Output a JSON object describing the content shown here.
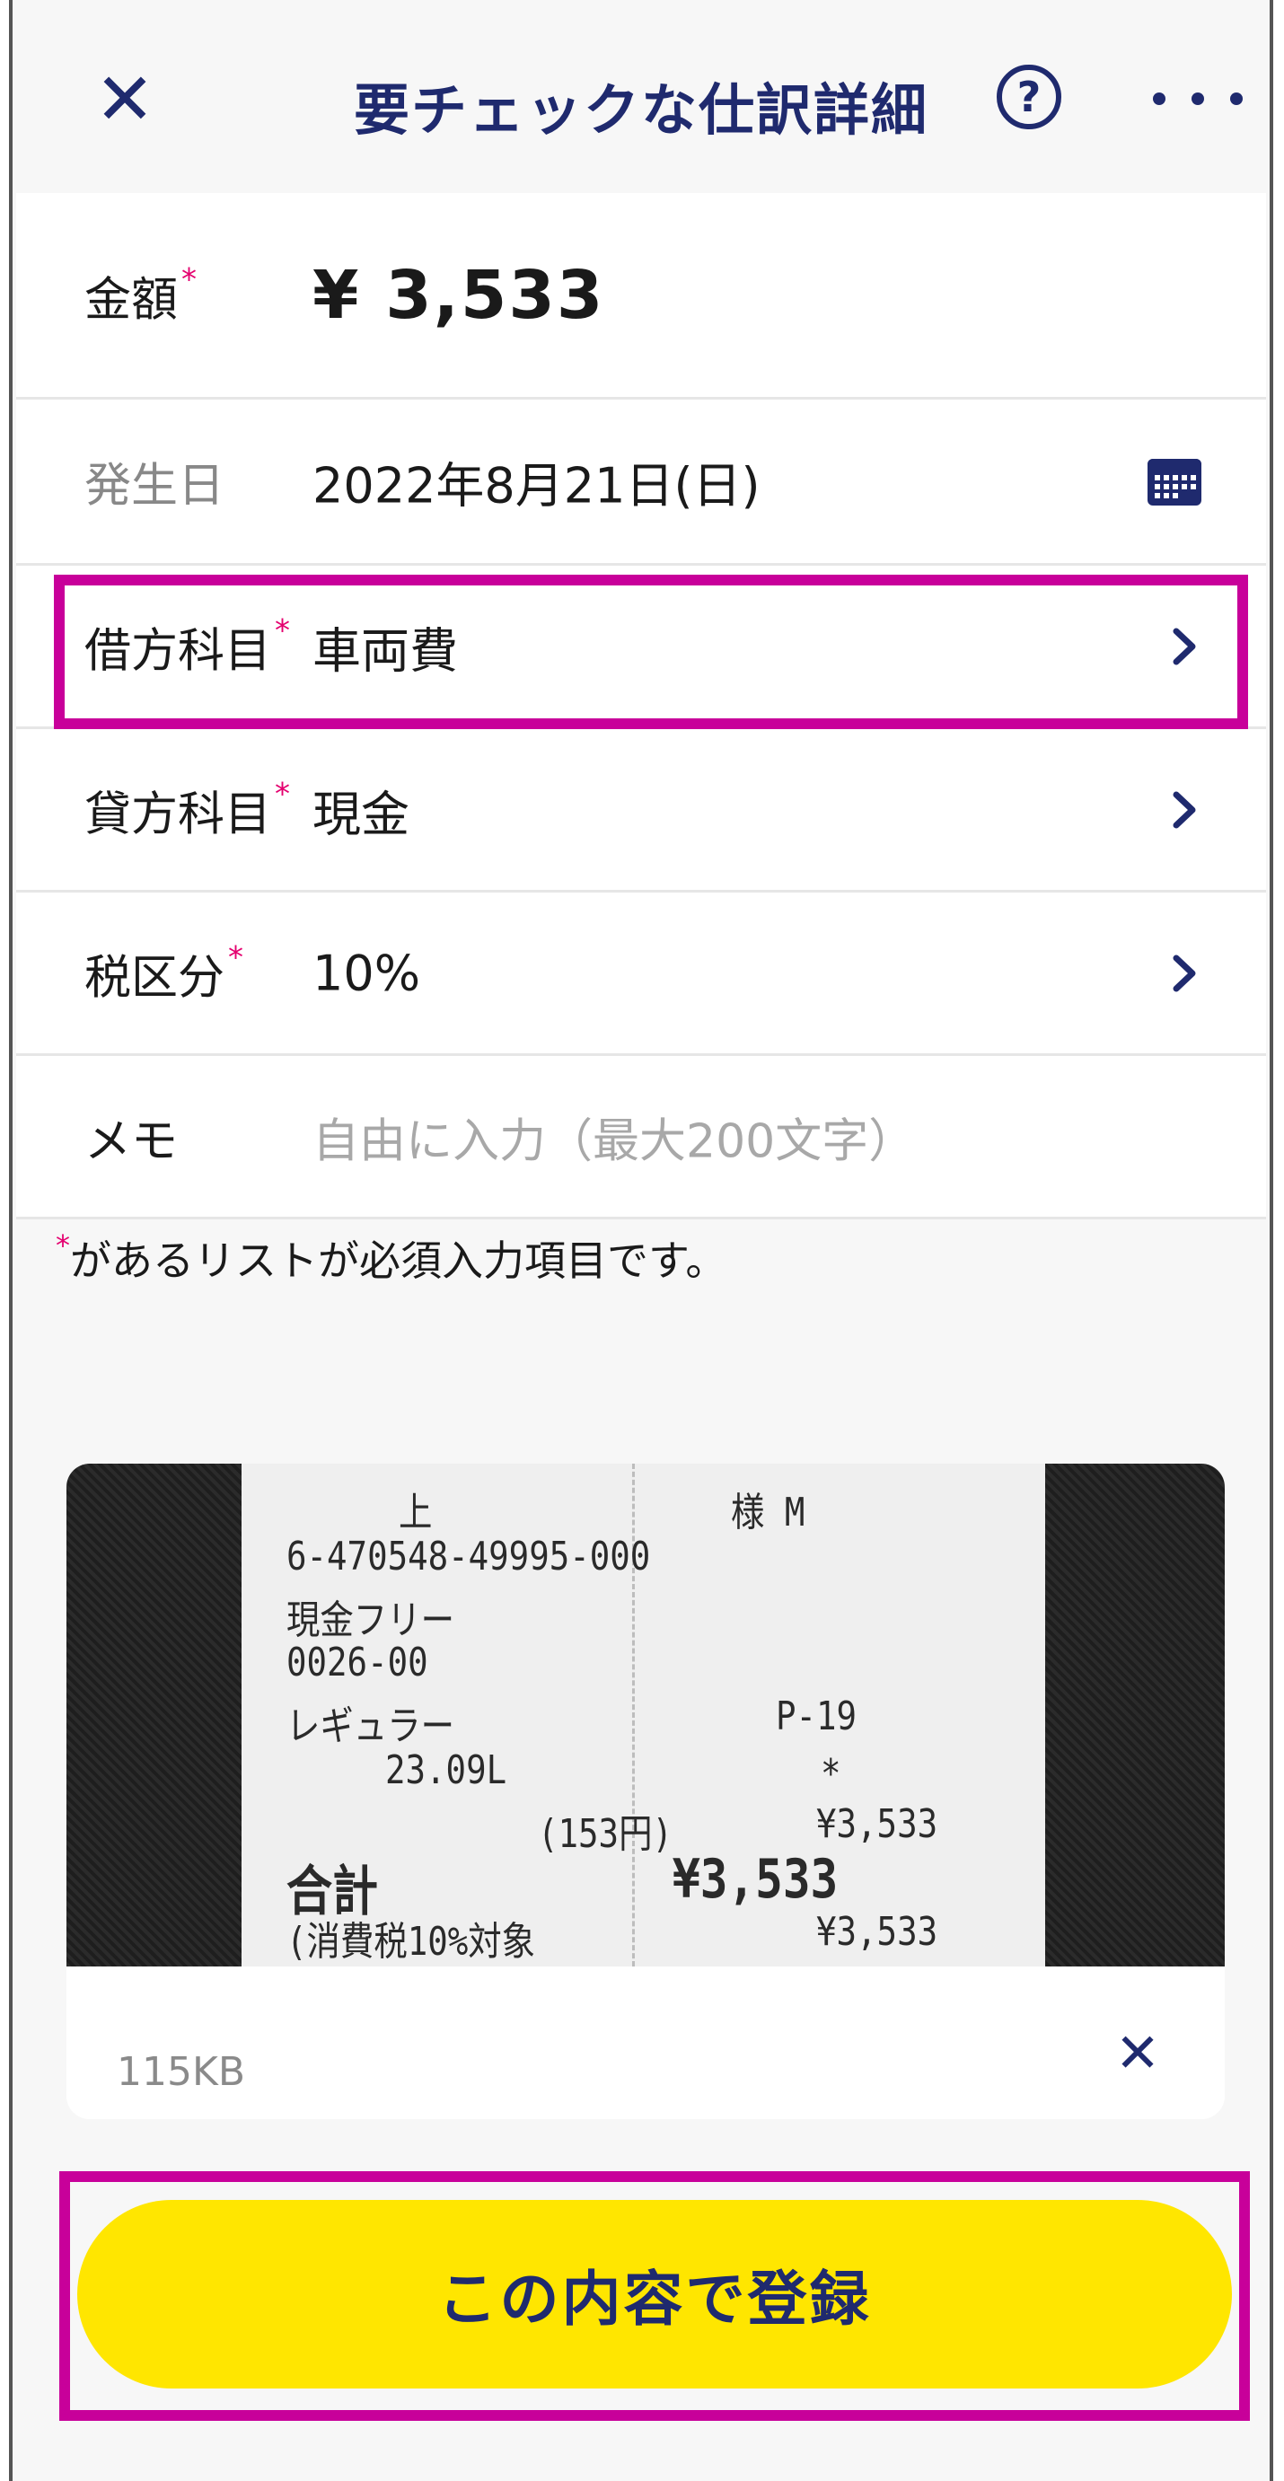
{
  "header": {
    "close_label": "✕",
    "title": "要チェックな仕訳詳細",
    "help_label": "?"
  },
  "form": {
    "amount": {
      "label": "金額",
      "required_mark": "*",
      "value": "¥ 3,533"
    },
    "date": {
      "label": "発生日",
      "value": "2022年8月21日(日)"
    },
    "debit": {
      "label": "借方科目",
      "required_mark": "*",
      "value": "車両費"
    },
    "credit": {
      "label": "貸方科目",
      "required_mark": "*",
      "value": "現金"
    },
    "tax": {
      "label": "税区分",
      "required_mark": "*",
      "value": "10%"
    },
    "memo": {
      "label": "メモ",
      "placeholder": "自由に入力（最大200文字）"
    }
  },
  "note": {
    "mark": "*",
    "text": "があるリストが必須入力項目です。"
  },
  "receipt": {
    "lines": [
      "上",
      "様 M",
      "6-470548-49995-000",
      "現金フリー",
      "0026-00",
      "レギュラー",
      "P-19",
      "23.09L",
      "*",
      "(153円)",
      "¥3,533",
      "合計",
      "¥3,533",
      "(消費税10%対象",
      "¥3,533"
    ],
    "file_size": "115KB",
    "remove_label": "✕"
  },
  "submit": {
    "label": "この内容で登録"
  },
  "colors": {
    "navy": "#1f2a6e",
    "required": "#e4006f",
    "highlight": "#c8009a",
    "button": "#ffe600"
  }
}
